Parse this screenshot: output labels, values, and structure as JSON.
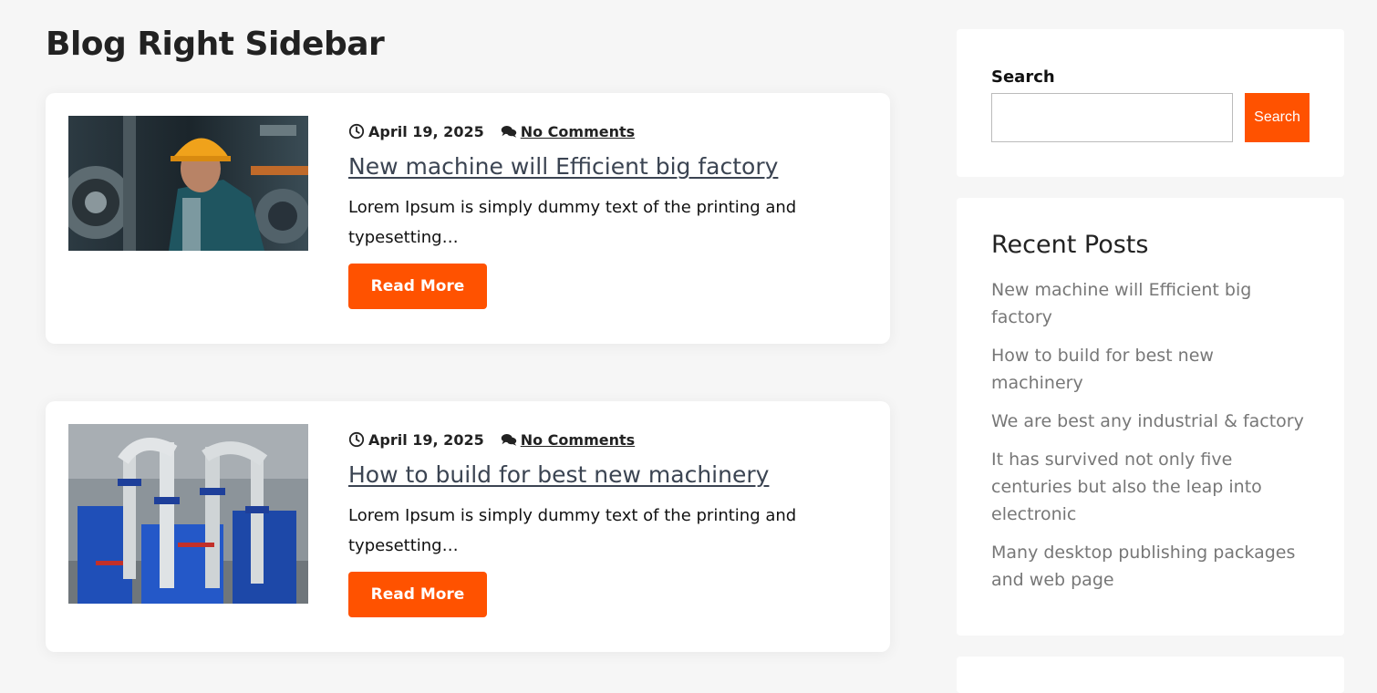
{
  "page": {
    "title": "Blog Right Sidebar"
  },
  "posts": [
    {
      "date": "April 19, 2025",
      "comments": "No Comments",
      "title": "New machine will Efficient big factory",
      "excerpt": "Lorem Ipsum is simply dummy text of the printing and typesetting…",
      "read_more": "Read More"
    },
    {
      "date": "April 19, 2025",
      "comments": "No Comments",
      "title": "How to build for best new machinery",
      "excerpt": "Lorem Ipsum is simply dummy text of the printing and typesetting…",
      "read_more": "Read More"
    }
  ],
  "sidebar": {
    "search": {
      "label": "Search",
      "button": "Search",
      "value": "",
      "placeholder": ""
    },
    "recent_posts": {
      "heading": "Recent Posts",
      "items": [
        "New machine will Efficient big factory",
        "How to build for best new machinery",
        "We are best any industrial & factory",
        "It has survived not only five centuries but also the leap into electronic",
        "Many desktop publishing packages and web page"
      ]
    }
  },
  "colors": {
    "accent": "#ff5200",
    "background": "#f6f6f6",
    "title_link": "#3b4452",
    "muted": "#777777"
  },
  "icons": {
    "date": "clock-icon",
    "comments": "comments-icon"
  }
}
